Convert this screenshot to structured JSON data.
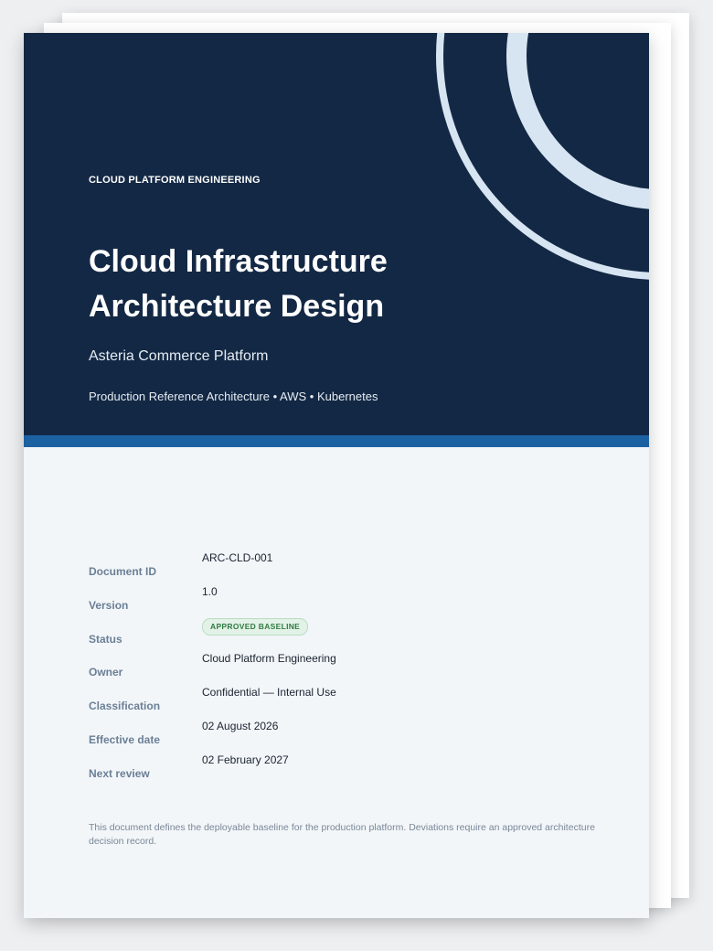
{
  "cover": {
    "kicker": "CLOUD PLATFORM ENGINEERING",
    "title": "Cloud Infrastructure Architecture Design",
    "subtitle": "Asteria Commerce Platform",
    "tagline": "Production Reference Architecture • AWS • Kubernetes"
  },
  "metadata": [
    {
      "label": "Document ID",
      "value": "ARC-CLD-001"
    },
    {
      "label": "Version",
      "value": "1.0"
    },
    {
      "label": "Status",
      "value": "APPROVED BASELINE"
    },
    {
      "label": "Owner",
      "value": "Cloud Platform Engineering"
    },
    {
      "label": "Classification",
      "value": "Confidential — Internal Use"
    },
    {
      "label": "Effective date",
      "value": "02 August 2026"
    },
    {
      "label": "Next review",
      "value": "02 February 2027"
    }
  ],
  "note": "This document defines the deployable baseline for the production platform. Deviations require an approved architecture decision record.",
  "colors": {
    "hero_background": "#132844",
    "accent_stripe": "#1c62a2",
    "ring_color": "#d7e5f2",
    "status_badge_background": "#e3f2e6",
    "status_badge_text": "#2f7a44"
  }
}
